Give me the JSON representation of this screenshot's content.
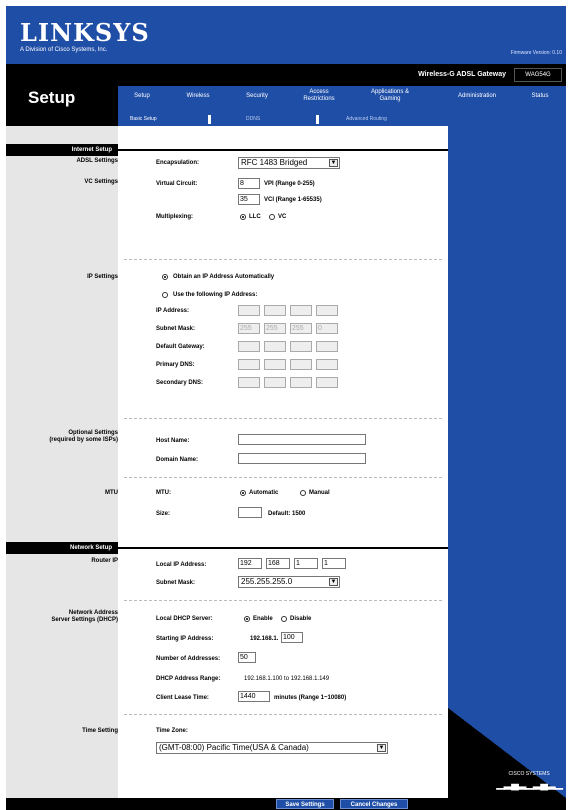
{
  "header": {
    "logo": "LINKSYS",
    "logo_sub": "A Division of Cisco Systems, Inc.",
    "firmware": "Firmware Version: 0.10",
    "product_name": "Wireless-G ADSL Gateway",
    "model": "WAG54G",
    "section": "Setup"
  },
  "tabs": [
    {
      "label": "Setup"
    },
    {
      "label": "Wireless"
    },
    {
      "label": "Security"
    },
    {
      "label": "Access Restrictions"
    },
    {
      "label": "Applications & Gaming"
    },
    {
      "label": "Administration"
    },
    {
      "label": "Status"
    }
  ],
  "subtabs": [
    {
      "label": "Basic Setup"
    },
    {
      "label": "DDNS"
    },
    {
      "label": "Advanced Routing"
    }
  ],
  "groups": {
    "internet_setup": "Internet Setup",
    "network_setup": "Network Setup"
  },
  "side_labels": {
    "adsl": "ADSL Settings",
    "vc": "VC Settings",
    "ip": "IP Settings",
    "optional": "Optional Settings",
    "optional_sub": "(required by some ISPs)",
    "mtu": "MTU",
    "router_ip": "Router IP",
    "dhcp": "Network Address",
    "dhcp_sub": "Server Settings (DHCP)",
    "time": "Time Setting"
  },
  "adsl": {
    "encapsulation_label": "Encapsulation:",
    "encapsulation_value": "RFC 1483 Bridged"
  },
  "vc": {
    "virtual_circuit_label": "Virtual Circuit:",
    "vpi_value": "8",
    "vpi_hint": "VPI (Range 0-255)",
    "vci_value": "35",
    "vci_hint": "VCI (Range 1-65535)",
    "multiplexing_label": "Multiplexing:",
    "llc": "LLC",
    "vc": "VC"
  },
  "ip_settings": {
    "auto_label": "Obtain an IP Address Automatically",
    "manual_label": "Use the following IP Address:",
    "ip_address": "IP Address:",
    "subnet_mask": "Subnet Mask:",
    "default_gateway": "Default Gateway:",
    "primary_dns": "Primary DNS:",
    "secondary_dns": "Secondary DNS:",
    "subnet_parts": [
      "255",
      "255",
      "255",
      "0"
    ]
  },
  "optional": {
    "host_name": "Host Name:",
    "domain_name": "Domain Name:"
  },
  "mtu": {
    "mtu_label": "MTU:",
    "automatic": "Automatic",
    "manual": "Manual",
    "size_label": "Size:",
    "size_hint": "Default: 1500"
  },
  "router_ip": {
    "local_ip_label": "Local IP Address:",
    "ip_parts": [
      "192",
      "168",
      "1",
      "1"
    ],
    "subnet_label": "Subnet Mask:",
    "subnet_value": "255.255.255.0"
  },
  "dhcp": {
    "server_label": "Local DHCP Server:",
    "enable": "Enable",
    "disable": "Disable",
    "start_label": "Starting IP Address:",
    "start_prefix": "192.168.1.",
    "start_value": "100",
    "count_label": "Number of Addresses:",
    "count_value": "50",
    "range_label": "DHCP Address Range:",
    "range_value": "192.168.1.100 to 192.168.1.149",
    "lease_label": "Client Lease Time:",
    "lease_value": "1440",
    "lease_hint": "minutes (Range 1~10080)"
  },
  "time": {
    "zone_label": "Time Zone:",
    "zone_value": "(GMT-08:00) Pacific Time(USA & Canada)"
  },
  "footer": {
    "save": "Save Settings",
    "cancel": "Cancel Changes"
  },
  "brand": {
    "cisco": "CISCO SYSTEMS"
  },
  "colors": {
    "brand_blue": "#1f4ea6",
    "black": "#000000",
    "panel_grey": "#e6e6e6"
  }
}
